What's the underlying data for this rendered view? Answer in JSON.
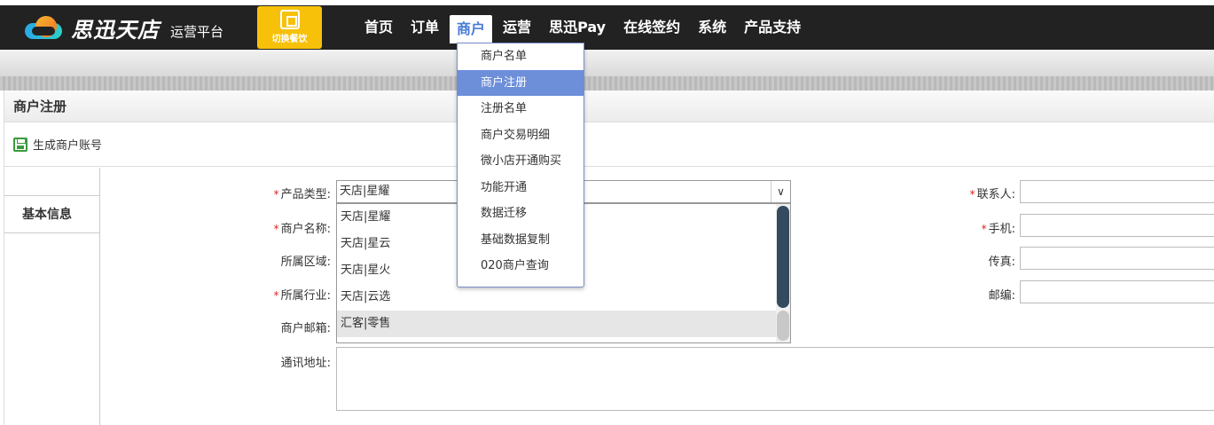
{
  "header": {
    "brand": "思迅天店",
    "subtitle": "运营平台",
    "switch_label": "切换餐饮"
  },
  "nav": {
    "items": [
      {
        "label": "首页"
      },
      {
        "label": "订单"
      },
      {
        "label": "商户",
        "active": true
      },
      {
        "label": "运营"
      },
      {
        "label": "思迅Pay"
      },
      {
        "label": "在线签约"
      },
      {
        "label": "系统"
      },
      {
        "label": "产品支持"
      }
    ]
  },
  "dropdown": {
    "items": [
      {
        "label": "商户名单"
      },
      {
        "label": "商户注册",
        "active": true
      },
      {
        "label": "注册名单"
      },
      {
        "label": "商户交易明细"
      },
      {
        "label": "微小店开通购买"
      },
      {
        "label": "功能开通"
      },
      {
        "label": "数据迁移"
      },
      {
        "label": "基础数据复制"
      },
      {
        "label": "020商户查询"
      }
    ]
  },
  "panel": {
    "title": "商户注册",
    "toolbar_button": "生成商户账号",
    "tab_label": "基本信息"
  },
  "form": {
    "product_type_label": "产品类型:",
    "product_type_value": "天店|星耀",
    "merchant_name_label": "商户名称:",
    "region_label": "所属区域:",
    "industry_label": "所属行业:",
    "email_label": "商户邮箱:",
    "address_label": "通讯地址:",
    "contact_label": "联系人:",
    "phone_label": "手机:",
    "fax_label": "传真:",
    "zip_label": "邮编:",
    "options": [
      "天店|星耀",
      "天店|星云",
      "天店|星火",
      "天店|云选",
      "汇客|零售"
    ],
    "highlighted_option": "汇客|零售",
    "scroll_position": 0.0
  },
  "colors": {
    "topbar": "#222222",
    "switch": "#f7c10a",
    "accent": "#6d8ed9",
    "required": "#dd2222"
  }
}
